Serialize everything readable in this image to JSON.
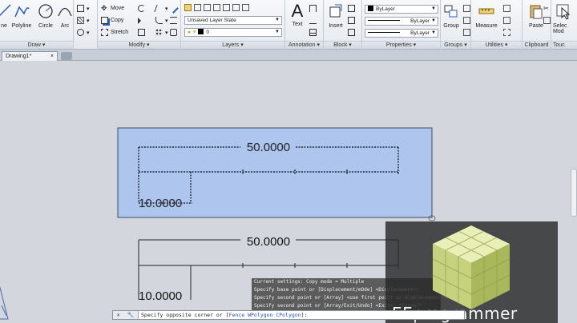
{
  "ribbon": {
    "draw": {
      "title": "Draw",
      "line_label": "ne",
      "polyline_label": "Polyline",
      "circle_label": "Circle",
      "arc_label": "Arc"
    },
    "modify": {
      "title": "Modify",
      "move_label": "Move",
      "copy_label": "Copy",
      "stretch_label": "Stretch"
    },
    "layers": {
      "title": "Layers",
      "layer_state": "Unsaved Layer State",
      "current_layer": "0"
    },
    "annotation": {
      "title": "Annotation",
      "text_label": "Text"
    },
    "block": {
      "title": "Block",
      "insert_label": "Insert"
    },
    "properties": {
      "title": "Properties",
      "color": "ByLayer",
      "linetype": "ByLayer",
      "lineweight": "ByLayer"
    },
    "groups": {
      "title": "Groups",
      "group_label": "Group"
    },
    "utilities": {
      "title": "Utilities",
      "measure_label": "Measure"
    },
    "clipboard": {
      "title": "Clipboard",
      "paste_label": "Paste"
    },
    "touch": {
      "title": "Touc",
      "select_label_1": "Selec",
      "select_label_2": "Mod"
    }
  },
  "tabs": {
    "document": "Drawing1*",
    "close": "×"
  },
  "drawing": {
    "selected_dim_top": "50.0000",
    "selected_dim_left": "10.0000",
    "dim_top": "50.0000",
    "dim_left": "10.0000"
  },
  "command_history": [
    "Current settings:  Copy mode = Multiple",
    "Specify base point or [Displacement/mOde] <Displacement>:",
    "Specify second point or [Array] <use first point as displacement>:",
    "Specify second point or [Array/Exit/Undo] <Exit>: *Cancel*"
  ],
  "command_line": {
    "prompt": "Specify opposite corner or [",
    "opt_fence": "Fence",
    "opt_wpolygon": "WPolygon",
    "opt_cpolygon": "CPolygon",
    "suffix": "]:"
  },
  "watermark": {
    "text": "EEprogrammer"
  },
  "colors": {
    "selection_fill": "#aec5ed",
    "selection_border": "#3b4b63",
    "canvas": "#d3d7dd",
    "ribbon": "#eef0f3"
  }
}
